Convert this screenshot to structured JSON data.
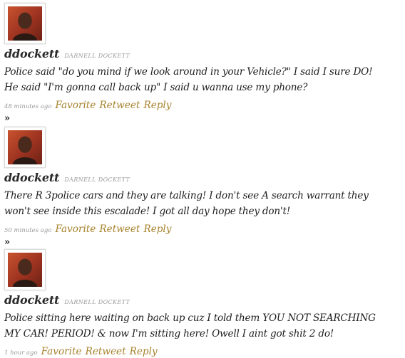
{
  "tweets": [
    {
      "username": "ddockett",
      "fullname": "DARNELL DOCKETT",
      "lines": [
        "Police said \"do you mind if we look around in your Vehicle?\" I said I sure DO!",
        "He said \"I'm gonna call back up\" I said u wanna use my phone?"
      ],
      "time": "48 minutes ago",
      "favorite": "Favorite",
      "retweet": "Retweet",
      "reply": "Reply",
      "separator": "»"
    },
    {
      "username": "ddockett",
      "fullname": "DARNELL DOCKETT",
      "lines": [
        "There R 3police cars and they are talking! I don't see A search warrant they",
        "won't see inside this escalade! I got all day hope they don't!"
      ],
      "time": "50 minutes ago",
      "favorite": "Favorite",
      "retweet": "Retweet",
      "reply": "Reply",
      "separator": "»"
    },
    {
      "username": "ddockett",
      "fullname": "DARNELL DOCKETT",
      "lines": [
        "Police sitting here waiting on back up cuz I told them YOU NOT SEARCHING",
        "MY CAR! PERIOD! & now I'm sitting here! Owell I aint got shit 2 do!"
      ],
      "time": "1 hour ago",
      "favorite": "Favorite",
      "retweet": "Retweet",
      "reply": "Reply"
    }
  ],
  "colors": {
    "action_link": "#a7832e",
    "meta_gray": "#9a9a9a",
    "text": "#1e1e1e"
  },
  "icons": {
    "avatar": "user-avatar-photo"
  }
}
